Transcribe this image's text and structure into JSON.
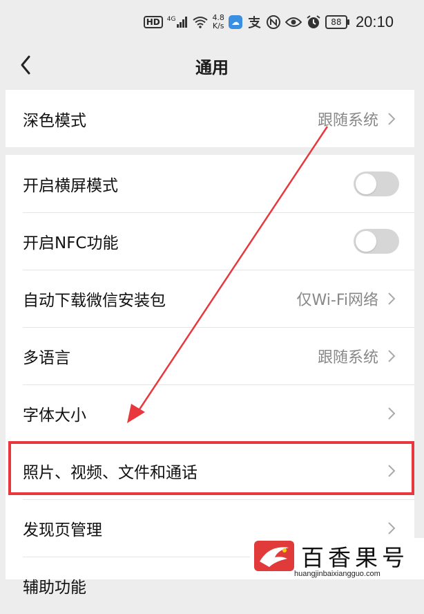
{
  "status_bar": {
    "hd_badge": "HD",
    "net_type": "4G",
    "speed_value": "4.8",
    "speed_unit": "K/s",
    "battery": "88",
    "time": "20:10"
  },
  "nav": {
    "title": "通用"
  },
  "group1": [
    {
      "label": "深色模式",
      "value": "跟随系统"
    }
  ],
  "group2": [
    {
      "label": "开启横屏模式",
      "toggle": "off"
    },
    {
      "label": "开启NFC功能",
      "toggle": "off"
    },
    {
      "label": "自动下载微信安装包",
      "value": "仅Wi-Fi网络"
    },
    {
      "label": "多语言",
      "value": "跟随系统"
    },
    {
      "label": "字体大小"
    },
    {
      "label": "照片、视频、文件和通话"
    },
    {
      "label": "发现页管理"
    },
    {
      "label": "辅助功能"
    }
  ],
  "watermark": {
    "brand": "百香果号",
    "domain": "huangjinbaixiangguo.com"
  },
  "colors": {
    "highlight": "#e8383d",
    "toggle_off": "#d6d6d6"
  }
}
